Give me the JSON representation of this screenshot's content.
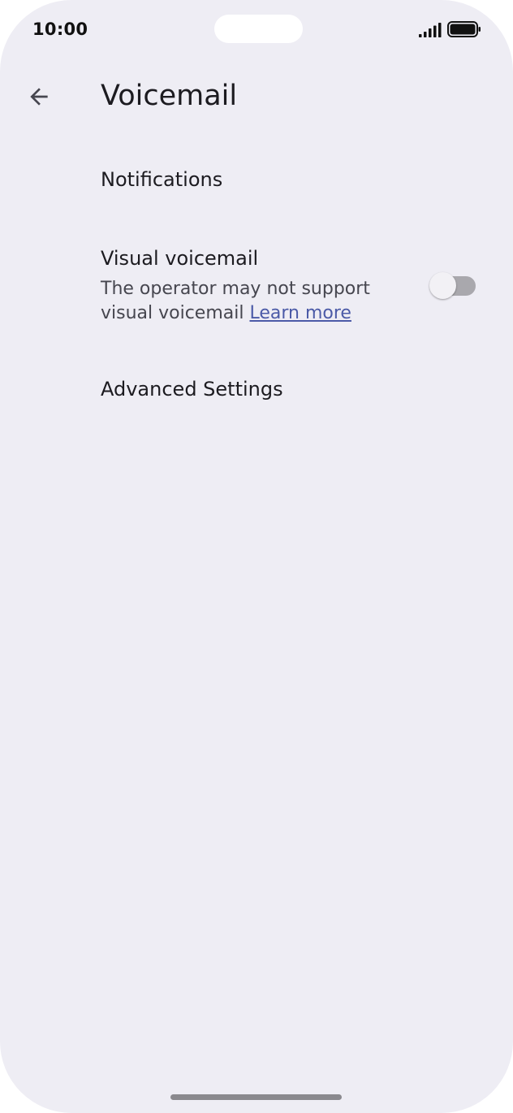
{
  "status_bar": {
    "time": "10:00",
    "icons": [
      "signal-icon",
      "battery-icon"
    ]
  },
  "header": {
    "back_icon": "arrow-back-icon",
    "title": "Voicemail"
  },
  "settings": {
    "notifications": {
      "title": "Notifications"
    },
    "visual_voicemail": {
      "title": "Visual voicemail",
      "summary": "The operator may not support visual voicemail",
      "link": "Learn more",
      "toggle_on": false
    },
    "advanced": {
      "title": "Advanced Settings"
    }
  },
  "colors": {
    "background": "#eeedf4",
    "link": "#4b5aa7",
    "toggle_track_off": "#a9a8ad"
  }
}
